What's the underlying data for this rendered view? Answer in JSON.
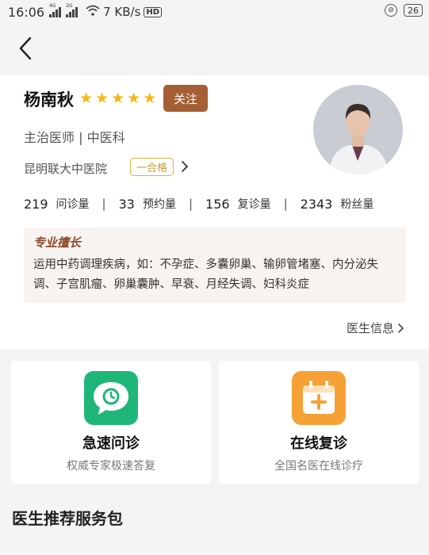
{
  "status_bar": {
    "time": "16:06",
    "net1": "4G",
    "net2": "2G",
    "speed": "7 KB/s",
    "hd": "HD",
    "battery": "26"
  },
  "doctor": {
    "name": "杨南秋",
    "rating": 5,
    "follow_label": "关注",
    "title": "主治医师 | 中医科",
    "hospital": "昆明联大中医院",
    "grade": "一合格",
    "stats": [
      {
        "value": "219",
        "label": "问诊量"
      },
      {
        "value": "33",
        "label": "预约量"
      },
      {
        "value": "156",
        "label": "复诊量"
      },
      {
        "value": "2343",
        "label": "粉丝量"
      }
    ],
    "stat_separator": "|",
    "expertise_title": "专业擅长",
    "expertise_text": "运用中药调理疾病，如：不孕症、多囊卵巢、输卵管堵塞、内分泌失调、子宫肌瘤、卵巢囊肿、早衰、月经失调、妇科炎症",
    "info_link": "医生信息"
  },
  "services": [
    {
      "title": "急速问诊",
      "subtitle": "权威专家极速答复",
      "icon": "chat-clock-icon",
      "color": "#1fb67a"
    },
    {
      "title": "在线复诊",
      "subtitle": "全国名医在线诊疗",
      "icon": "calendar-plus-icon",
      "color": "#f6a135"
    }
  ],
  "section_title": "医生推荐服务包"
}
